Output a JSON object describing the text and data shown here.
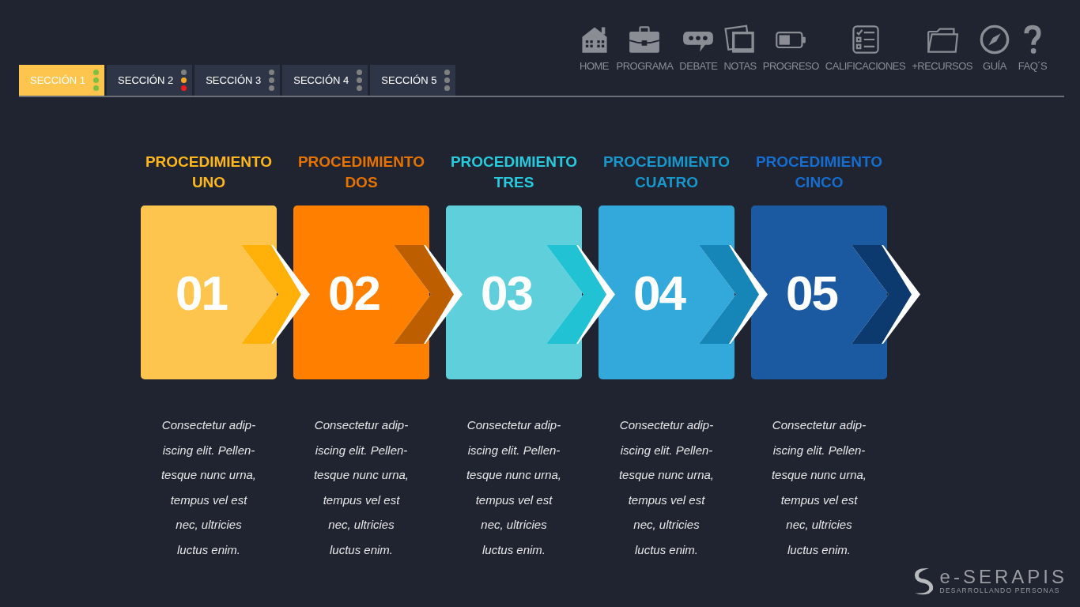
{
  "tabs": [
    {
      "label": "SECCIÓN 1",
      "selected": true,
      "dots": [
        {
          "color": "#7bc043"
        },
        {
          "color": "#7bc043"
        },
        {
          "color": "#7bc043"
        }
      ]
    },
    {
      "label": "SECCIÓN 2",
      "selected": false,
      "dots": [
        {
          "color": "#808080"
        },
        {
          "color": "#f5a623"
        },
        {
          "color": "#ee1c1c"
        }
      ]
    },
    {
      "label": "SECCIÓN 3",
      "selected": false,
      "dots": [
        {
          "color": "#808080"
        },
        {
          "color": "#808080"
        },
        {
          "color": "#808080"
        }
      ]
    },
    {
      "label": "SECCIÓN 4",
      "selected": false,
      "dots": [
        {
          "color": "#808080"
        },
        {
          "color": "#808080"
        },
        {
          "color": "#808080"
        }
      ]
    },
    {
      "label": "SECCIÓN 5",
      "selected": false,
      "dots": [
        {
          "color": "#808080"
        },
        {
          "color": "#808080"
        },
        {
          "color": "#808080"
        }
      ]
    }
  ],
  "nav": [
    {
      "kind": "home",
      "label": "HOME"
    },
    {
      "kind": "briefcase",
      "label": "PROGRAMA"
    },
    {
      "kind": "chat",
      "label": "DEBATE"
    },
    {
      "kind": "photos",
      "label": "NOTAS"
    },
    {
      "kind": "battery",
      "label": "PROGRESO"
    },
    {
      "kind": "checklist",
      "label": "CALIFICACIONES"
    },
    {
      "kind": "folder",
      "label": "+RECURSOS"
    },
    {
      "kind": "compass",
      "label": "GUÍA"
    },
    {
      "kind": "question",
      "label": "FAQ´S"
    }
  ],
  "steps": [
    {
      "title": [
        "PROCEDIMIENTO",
        "UNO"
      ],
      "number": "01",
      "color": "#fdc54e",
      "lines": [
        "Consectetur adip-",
        "iscing elit. Pellen-",
        "tesque nunc urna,",
        "tempus vel est",
        "nec, ultricies",
        "luctus enim."
      ]
    },
    {
      "title": [
        "PROCEDIMIENTO",
        "DOS"
      ],
      "number": "02",
      "color": "#ff8000",
      "lines": [
        "Consectetur adip-",
        "iscing elit. Pellen-",
        "tesque nunc urna,",
        "tempus vel est",
        "nec, ultricies",
        "luctus enim."
      ]
    },
    {
      "title": [
        "PROCEDIMIENTO",
        "TRES"
      ],
      "number": "03",
      "color": "#5ecfdb",
      "lines": [
        "Consectetur adip-",
        "iscing elit. Pellen-",
        "tesque nunc urna,",
        "tempus vel est",
        "nec, ultricies",
        "luctus enim."
      ]
    },
    {
      "title": [
        "PROCEDIMIENTO",
        "CUATRO"
      ],
      "number": "04",
      "color": "#33a8da",
      "lines": [
        "Consectetur adip-",
        "iscing elit. Pellen-",
        "tesque nunc urna,",
        "tempus vel est",
        "nec, ultricies",
        "luctus enim."
      ]
    },
    {
      "title": [
        "PROCEDIMIENTO",
        "CINCO"
      ],
      "number": "05",
      "color": "#1b5aa0",
      "lines": [
        "Consectetur adip-",
        "iscing elit. Pellen-",
        "tesque nunc urna,",
        "tempus vel est",
        "nec, ultricies",
        "luctus enim."
      ]
    }
  ],
  "logo": {
    "name": "e-SERAPIS",
    "tagline": "DESARROLLANDO PERSONAS"
  }
}
